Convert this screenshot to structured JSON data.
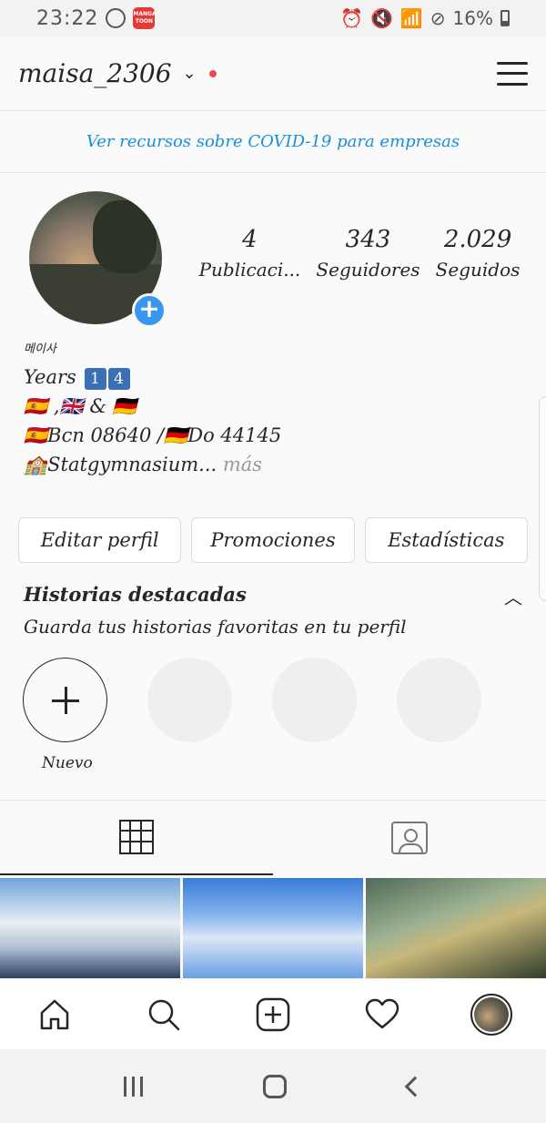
{
  "status_bar": {
    "time": "23:22",
    "app_badge": "MANGA TOON",
    "battery": "16%"
  },
  "header": {
    "username": "maisa_2306"
  },
  "covid_banner": "Ver recursos sobre COVID-19 para empresas",
  "profile": {
    "stats": [
      {
        "value": "4",
        "label": "Publicaci..."
      },
      {
        "value": "343",
        "label": "Seguidores"
      },
      {
        "value": "2.029",
        "label": "Seguidos"
      }
    ]
  },
  "bio": {
    "name": "메이사",
    "line1": "Years",
    "line1_num1": "1",
    "line1_num2": "4",
    "line2": "🇪🇸 ,🇬🇧 & 🇩🇪",
    "line3": "🇪🇸Bcn 08640 /🇩🇪Do 44145",
    "line4": "🏫Statgymnasium...",
    "more": "más"
  },
  "buttons": {
    "edit": "Editar perfil",
    "promotions": "Promociones",
    "stats": "Estadísticas"
  },
  "highlights": {
    "title": "Historias destacadas",
    "subtitle": "Guarda tus historias favoritas en tu perfil",
    "new_label": "Nuevo"
  },
  "colors": {
    "accent": "#3897f0",
    "link": "#1a8fd8",
    "notification": "#ed4956"
  }
}
